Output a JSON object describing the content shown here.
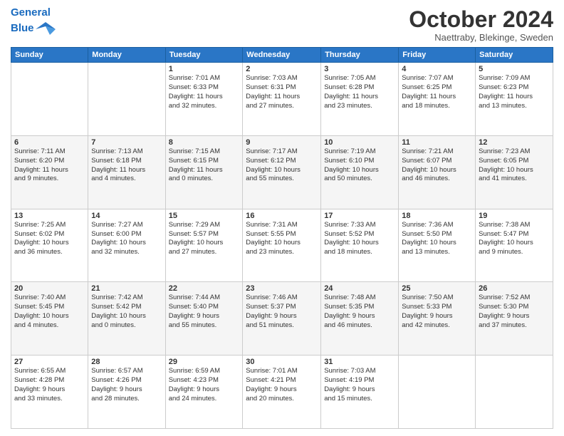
{
  "header": {
    "logo_line1": "General",
    "logo_line2": "Blue",
    "month": "October 2024",
    "location": "Naettraby, Blekinge, Sweden"
  },
  "days_header": [
    "Sunday",
    "Monday",
    "Tuesday",
    "Wednesday",
    "Thursday",
    "Friday",
    "Saturday"
  ],
  "weeks": [
    [
      {
        "day": "",
        "content": ""
      },
      {
        "day": "",
        "content": ""
      },
      {
        "day": "1",
        "content": "Sunrise: 7:01 AM\nSunset: 6:33 PM\nDaylight: 11 hours\nand 32 minutes."
      },
      {
        "day": "2",
        "content": "Sunrise: 7:03 AM\nSunset: 6:31 PM\nDaylight: 11 hours\nand 27 minutes."
      },
      {
        "day": "3",
        "content": "Sunrise: 7:05 AM\nSunset: 6:28 PM\nDaylight: 11 hours\nand 23 minutes."
      },
      {
        "day": "4",
        "content": "Sunrise: 7:07 AM\nSunset: 6:25 PM\nDaylight: 11 hours\nand 18 minutes."
      },
      {
        "day": "5",
        "content": "Sunrise: 7:09 AM\nSunset: 6:23 PM\nDaylight: 11 hours\nand 13 minutes."
      }
    ],
    [
      {
        "day": "6",
        "content": "Sunrise: 7:11 AM\nSunset: 6:20 PM\nDaylight: 11 hours\nand 9 minutes."
      },
      {
        "day": "7",
        "content": "Sunrise: 7:13 AM\nSunset: 6:18 PM\nDaylight: 11 hours\nand 4 minutes."
      },
      {
        "day": "8",
        "content": "Sunrise: 7:15 AM\nSunset: 6:15 PM\nDaylight: 11 hours\nand 0 minutes."
      },
      {
        "day": "9",
        "content": "Sunrise: 7:17 AM\nSunset: 6:12 PM\nDaylight: 10 hours\nand 55 minutes."
      },
      {
        "day": "10",
        "content": "Sunrise: 7:19 AM\nSunset: 6:10 PM\nDaylight: 10 hours\nand 50 minutes."
      },
      {
        "day": "11",
        "content": "Sunrise: 7:21 AM\nSunset: 6:07 PM\nDaylight: 10 hours\nand 46 minutes."
      },
      {
        "day": "12",
        "content": "Sunrise: 7:23 AM\nSunset: 6:05 PM\nDaylight: 10 hours\nand 41 minutes."
      }
    ],
    [
      {
        "day": "13",
        "content": "Sunrise: 7:25 AM\nSunset: 6:02 PM\nDaylight: 10 hours\nand 36 minutes."
      },
      {
        "day": "14",
        "content": "Sunrise: 7:27 AM\nSunset: 6:00 PM\nDaylight: 10 hours\nand 32 minutes."
      },
      {
        "day": "15",
        "content": "Sunrise: 7:29 AM\nSunset: 5:57 PM\nDaylight: 10 hours\nand 27 minutes."
      },
      {
        "day": "16",
        "content": "Sunrise: 7:31 AM\nSunset: 5:55 PM\nDaylight: 10 hours\nand 23 minutes."
      },
      {
        "day": "17",
        "content": "Sunrise: 7:33 AM\nSunset: 5:52 PM\nDaylight: 10 hours\nand 18 minutes."
      },
      {
        "day": "18",
        "content": "Sunrise: 7:36 AM\nSunset: 5:50 PM\nDaylight: 10 hours\nand 13 minutes."
      },
      {
        "day": "19",
        "content": "Sunrise: 7:38 AM\nSunset: 5:47 PM\nDaylight: 10 hours\nand 9 minutes."
      }
    ],
    [
      {
        "day": "20",
        "content": "Sunrise: 7:40 AM\nSunset: 5:45 PM\nDaylight: 10 hours\nand 4 minutes."
      },
      {
        "day": "21",
        "content": "Sunrise: 7:42 AM\nSunset: 5:42 PM\nDaylight: 10 hours\nand 0 minutes."
      },
      {
        "day": "22",
        "content": "Sunrise: 7:44 AM\nSunset: 5:40 PM\nDaylight: 9 hours\nand 55 minutes."
      },
      {
        "day": "23",
        "content": "Sunrise: 7:46 AM\nSunset: 5:37 PM\nDaylight: 9 hours\nand 51 minutes."
      },
      {
        "day": "24",
        "content": "Sunrise: 7:48 AM\nSunset: 5:35 PM\nDaylight: 9 hours\nand 46 minutes."
      },
      {
        "day": "25",
        "content": "Sunrise: 7:50 AM\nSunset: 5:33 PM\nDaylight: 9 hours\nand 42 minutes."
      },
      {
        "day": "26",
        "content": "Sunrise: 7:52 AM\nSunset: 5:30 PM\nDaylight: 9 hours\nand 37 minutes."
      }
    ],
    [
      {
        "day": "27",
        "content": "Sunrise: 6:55 AM\nSunset: 4:28 PM\nDaylight: 9 hours\nand 33 minutes."
      },
      {
        "day": "28",
        "content": "Sunrise: 6:57 AM\nSunset: 4:26 PM\nDaylight: 9 hours\nand 28 minutes."
      },
      {
        "day": "29",
        "content": "Sunrise: 6:59 AM\nSunset: 4:23 PM\nDaylight: 9 hours\nand 24 minutes."
      },
      {
        "day": "30",
        "content": "Sunrise: 7:01 AM\nSunset: 4:21 PM\nDaylight: 9 hours\nand 20 minutes."
      },
      {
        "day": "31",
        "content": "Sunrise: 7:03 AM\nSunset: 4:19 PM\nDaylight: 9 hours\nand 15 minutes."
      },
      {
        "day": "",
        "content": ""
      },
      {
        "day": "",
        "content": ""
      }
    ]
  ]
}
